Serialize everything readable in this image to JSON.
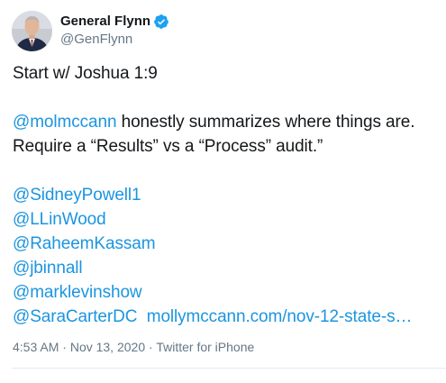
{
  "user": {
    "display_name": "General Flynn",
    "handle": "@GenFlynn",
    "verified_icon": "verified-badge-icon",
    "accent_color": "#1b95e0"
  },
  "tweet": {
    "line1": "Start w/ Joshua 1:9",
    "mention_molmccann": "@molmccann",
    "para2_rest": " honestly summarizes where things are.",
    "para2_line2": "Require a “Results” vs a “Process” audit.”",
    "mentions": [
      "@SidneyPowell1",
      "@LLinWood",
      "@RaheemKassam",
      "@jbinnall",
      "@marklevinshow",
      "@SaraCarterDC"
    ],
    "link": "mollymccann.com/nov-12-state-s…"
  },
  "meta": {
    "time": "4:53 AM",
    "separator1": " · ",
    "date": "Nov 13, 2020",
    "separator2": " · ",
    "source": "Twitter for iPhone"
  }
}
